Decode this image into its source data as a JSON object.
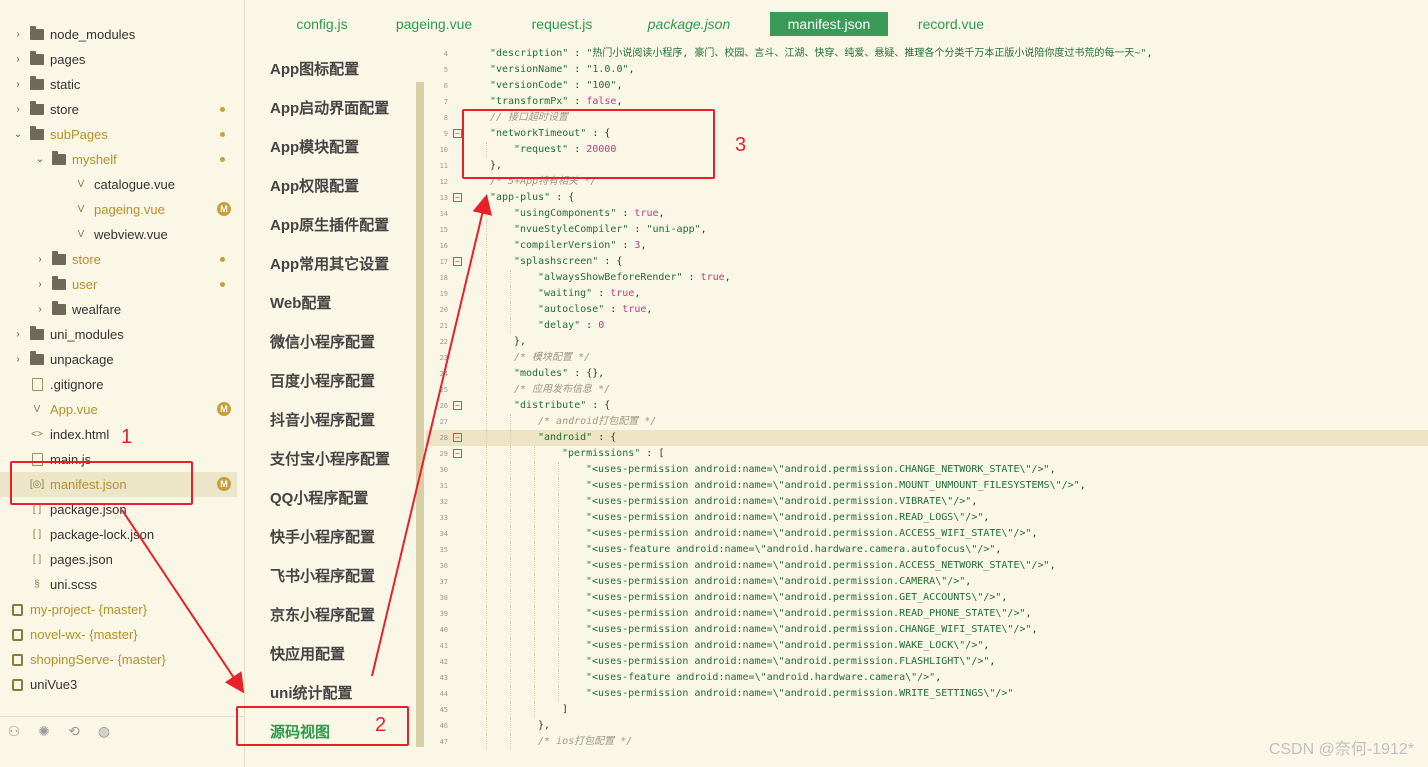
{
  "tree": {
    "items": [
      {
        "label": "node_modules",
        "type": "folder",
        "chev": "›",
        "indent": 0
      },
      {
        "label": "pages",
        "type": "folder",
        "chev": "›",
        "indent": 0
      },
      {
        "label": "static",
        "type": "folder",
        "chev": "›",
        "indent": 0
      },
      {
        "label": "store",
        "type": "folder",
        "chev": "›",
        "indent": 0,
        "dot": true
      },
      {
        "label": "subPages",
        "type": "folder",
        "chev": "⌄",
        "indent": 0,
        "dot": true,
        "yellow": true
      },
      {
        "label": "myshelf",
        "type": "folder",
        "chev": "⌄",
        "indent": 1,
        "dot": true,
        "yellow": true
      },
      {
        "label": "catalogue.vue",
        "type": "vue",
        "indent": 2
      },
      {
        "label": "pageing.vue",
        "type": "vue",
        "indent": 2,
        "badge": "M",
        "yellow": true
      },
      {
        "label": "webview.vue",
        "type": "vue",
        "indent": 2
      },
      {
        "label": "store",
        "type": "folder",
        "chev": "›",
        "indent": 1,
        "dot": true,
        "yellow": true
      },
      {
        "label": "user",
        "type": "folder",
        "chev": "›",
        "indent": 1,
        "dot": true,
        "yellow": true
      },
      {
        "label": "wealfare",
        "type": "folder",
        "chev": "›",
        "indent": 1
      },
      {
        "label": "uni_modules",
        "type": "folder",
        "chev": "›",
        "indent": 0
      },
      {
        "label": "unpackage",
        "type": "folder",
        "chev": "›",
        "indent": 0
      },
      {
        "label": ".gitignore",
        "type": "file",
        "indent": 0
      },
      {
        "label": "App.vue",
        "type": "vue",
        "indent": 0,
        "badge": "M",
        "yellow": true
      },
      {
        "label": "index.html",
        "type": "html",
        "indent": 0
      },
      {
        "label": "main.js",
        "type": "js",
        "indent": 0
      },
      {
        "label": "manifest.json",
        "type": "json-cfg",
        "indent": 0,
        "badge": "M",
        "yellow": true,
        "selected": true
      },
      {
        "label": "package.json",
        "type": "json",
        "indent": 0
      },
      {
        "label": "package-lock.json",
        "type": "json",
        "indent": 0
      },
      {
        "label": "pages.json",
        "type": "json",
        "indent": 0
      },
      {
        "label": "uni.scss",
        "type": "scss",
        "indent": 0
      }
    ],
    "projects": [
      {
        "name": "my-project",
        "branch": " - {master}"
      },
      {
        "name": "novel-wx",
        "branch": " - {master}"
      },
      {
        "name": "shopingServe",
        "branch": " - {master}"
      },
      {
        "name": "uniVue3",
        "branch": ""
      }
    ],
    "toolbar_icons": [
      "users-icon",
      "bug-icon",
      "git-icon",
      "globe-icon"
    ]
  },
  "tabs": [
    {
      "label": "config.js"
    },
    {
      "label": "pageing.vue"
    },
    {
      "label": "request.js"
    },
    {
      "label": "package.json",
      "italic": true
    },
    {
      "label": "manifest.json",
      "active": true
    },
    {
      "label": "record.vue"
    }
  ],
  "config_nav": [
    "App图标配置",
    "App启动界面配置",
    "App模块配置",
    "App权限配置",
    "App原生插件配置",
    "App常用其它设置",
    "Web配置",
    "微信小程序配置",
    "百度小程序配置",
    "抖音小程序配置",
    "支付宝小程序配置",
    "QQ小程序配置",
    "快手小程序配置",
    "飞书小程序配置",
    "京东小程序配置",
    "快应用配置",
    "uni统计配置",
    "源码视图"
  ],
  "config_nav_active": "源码视图",
  "code_lines": [
    {
      "n": "4",
      "ind": 1,
      "html": "<span class='s'>\"description\"</span> : <span class='s'>\"热门小说阅读小程序, 豪门、校园、言斗、江湖、快穿、纯爱、悬疑、推理各个分类千万本正版小说陪你度过书荒的每一天~\"</span>,"
    },
    {
      "n": "5",
      "ind": 1,
      "html": "<span class='s'>\"versionName\"</span> : <span class='s'>\"1.0.0\"</span>,"
    },
    {
      "n": "6",
      "ind": 1,
      "html": "<span class='s'>\"versionCode\"</span> : <span class='s'>\"100\"</span>,"
    },
    {
      "n": "7",
      "ind": 1,
      "html": "<span class='s'>\"transformPx\"</span> : <span class='b'>false</span>,"
    },
    {
      "n": "8",
      "ind": 1,
      "html": "<span class='cm'>// 接口超时设置</span>"
    },
    {
      "n": "9",
      "ind": 1,
      "fold": true,
      "html": "<span class='s'>\"networkTimeout\"</span> : {"
    },
    {
      "n": "10",
      "ind": 2,
      "html": "<span class='s'>\"request\"</span> : <span class='n'>20000</span>"
    },
    {
      "n": "11",
      "ind": 1,
      "html": "},"
    },
    {
      "n": "12",
      "ind": 1,
      "html": "<span class='cm'>/* 5+App特有相关 */</span>"
    },
    {
      "n": "13",
      "ind": 1,
      "fold": true,
      "html": "<span class='s'>\"app-plus\"</span> : {"
    },
    {
      "n": "14",
      "ind": 2,
      "html": "<span class='s'>\"usingComponents\"</span> : <span class='b'>true</span>,"
    },
    {
      "n": "15",
      "ind": 2,
      "html": "<span class='s'>\"nvueStyleCompiler\"</span> : <span class='s'>\"uni-app\"</span>,"
    },
    {
      "n": "16",
      "ind": 2,
      "html": "<span class='s'>\"compilerVersion\"</span> : <span class='n'>3</span>,"
    },
    {
      "n": "17",
      "ind": 2,
      "fold": true,
      "html": "<span class='s'>\"splashscreen\"</span> : {"
    },
    {
      "n": "18",
      "ind": 3,
      "html": "<span class='s'>\"alwaysShowBeforeRender\"</span> : <span class='b'>true</span>,"
    },
    {
      "n": "19",
      "ind": 3,
      "html": "<span class='s'>\"waiting\"</span> : <span class='b'>true</span>,"
    },
    {
      "n": "20",
      "ind": 3,
      "html": "<span class='s'>\"autoclose\"</span> : <span class='b'>true</span>,"
    },
    {
      "n": "21",
      "ind": 3,
      "html": "<span class='s'>\"delay\"</span> : <span class='n'>0</span>"
    },
    {
      "n": "22",
      "ind": 2,
      "html": "},"
    },
    {
      "n": "23",
      "ind": 2,
      "html": "<span class='cm'>/* 模块配置 */</span>"
    },
    {
      "n": "24",
      "ind": 2,
      "html": "<span class='s'>\"modules\"</span> : {},"
    },
    {
      "n": "25",
      "ind": 2,
      "html": "<span class='cm'>/* 应用发布信息 */</span>"
    },
    {
      "n": "26",
      "ind": 2,
      "fold": true,
      "html": "<span class='s'>\"distribute\"</span> : {"
    },
    {
      "n": "27",
      "ind": 3,
      "html": "<span class='cm'>/* android打包配置 */</span>"
    },
    {
      "n": "28",
      "ind": 3,
      "fold": true,
      "hl": true,
      "html": "<span class='s'>\"android\"</span> : {"
    },
    {
      "n": "29",
      "ind": 4,
      "fold": true,
      "html": "<span class='s'>\"permissions\"</span> : ["
    },
    {
      "n": "30",
      "ind": 5,
      "html": "<span class='s'>\"&lt;uses-permission android:name=\\\"android.permission.CHANGE_NETWORK_STATE\\\"/&gt;\"</span>,"
    },
    {
      "n": "31",
      "ind": 5,
      "html": "<span class='s'>\"&lt;uses-permission android:name=\\\"android.permission.MOUNT_UNMOUNT_FILESYSTEMS\\\"/&gt;\"</span>,"
    },
    {
      "n": "32",
      "ind": 5,
      "html": "<span class='s'>\"&lt;uses-permission android:name=\\\"android.permission.VIBRATE\\\"/&gt;\"</span>,"
    },
    {
      "n": "33",
      "ind": 5,
      "html": "<span class='s'>\"&lt;uses-permission android:name=\\\"android.permission.READ_LOGS\\\"/&gt;\"</span>,"
    },
    {
      "n": "34",
      "ind": 5,
      "html": "<span class='s'>\"&lt;uses-permission android:name=\\\"android.permission.ACCESS_WIFI_STATE\\\"/&gt;\"</span>,"
    },
    {
      "n": "35",
      "ind": 5,
      "html": "<span class='s'>\"&lt;uses-feature android:name=\\\"android.hardware.camera.autofocus\\\"/&gt;\"</span>,"
    },
    {
      "n": "36",
      "ind": 5,
      "html": "<span class='s'>\"&lt;uses-permission android:name=\\\"android.permission.ACCESS_NETWORK_STATE\\\"/&gt;\"</span>,"
    },
    {
      "n": "37",
      "ind": 5,
      "html": "<span class='s'>\"&lt;uses-permission android:name=\\\"android.permission.CAMERA\\\"/&gt;\"</span>,"
    },
    {
      "n": "38",
      "ind": 5,
      "html": "<span class='s'>\"&lt;uses-permission android:name=\\\"android.permission.GET_ACCOUNTS\\\"/&gt;\"</span>,"
    },
    {
      "n": "39",
      "ind": 5,
      "html": "<span class='s'>\"&lt;uses-permission android:name=\\\"android.permission.READ_PHONE_STATE\\\"/&gt;\"</span>,"
    },
    {
      "n": "40",
      "ind": 5,
      "html": "<span class='s'>\"&lt;uses-permission android:name=\\\"android.permission.CHANGE_WIFI_STATE\\\"/&gt;\"</span>,"
    },
    {
      "n": "41",
      "ind": 5,
      "html": "<span class='s'>\"&lt;uses-permission android:name=\\\"android.permission.WAKE_LOCK\\\"/&gt;\"</span>,"
    },
    {
      "n": "42",
      "ind": 5,
      "html": "<span class='s'>\"&lt;uses-permission android:name=\\\"android.permission.FLASHLIGHT\\\"/&gt;\"</span>,"
    },
    {
      "n": "43",
      "ind": 5,
      "html": "<span class='s'>\"&lt;uses-feature android:name=\\\"android.hardware.camera\\\"/&gt;\"</span>,"
    },
    {
      "n": "44",
      "ind": 5,
      "html": "<span class='s'>\"&lt;uses-permission android:name=\\\"android.permission.WRITE_SETTINGS\\\"/&gt;\"</span>"
    },
    {
      "n": "45",
      "ind": 4,
      "html": "]"
    },
    {
      "n": "46",
      "ind": 3,
      "html": "},"
    },
    {
      "n": "47",
      "ind": 3,
      "html": "<span class='cm'>/* ios打包配置 */</span>"
    }
  ],
  "annotations": [
    "1",
    "2",
    "3"
  ],
  "watermark": "CSDN @奈何-1912*",
  "colors": {
    "accent": "#3a9a58",
    "annotation_red": "#e8202a",
    "background": "#fbf7e6"
  }
}
